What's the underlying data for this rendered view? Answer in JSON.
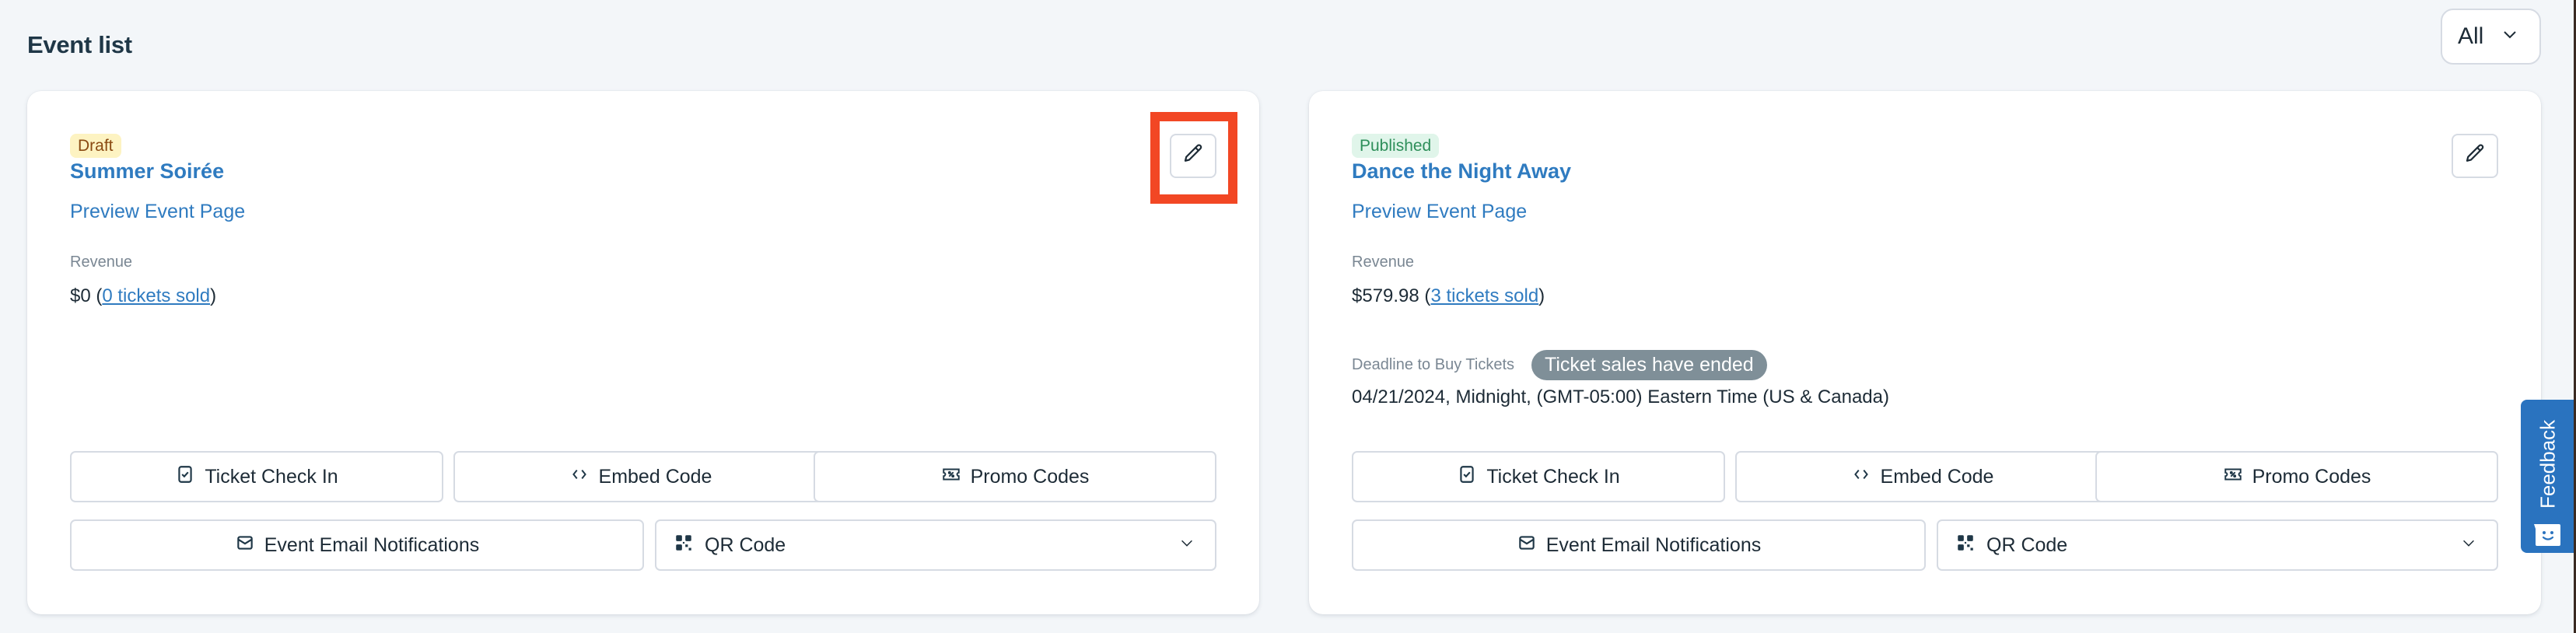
{
  "header": {
    "title": "Event list",
    "filter": {
      "selected": "All",
      "icon": "chevron-down-icon"
    }
  },
  "events": [
    {
      "status": "Draft",
      "status_color": "#fdf3c2",
      "title": "Summer Soirée",
      "preview_link": "Preview Event Page",
      "revenue_label": "Revenue",
      "revenue_amount": "$0",
      "tickets_sold": "0 tickets sold",
      "edit_icon": "pencil-icon",
      "highlighted": true,
      "buttons": {
        "ticket_check_in": "Ticket Check In",
        "embed_code": "Embed Code",
        "promo_codes": "Promo Codes",
        "email_notifications": "Event Email Notifications",
        "qr_code": "QR Code"
      }
    },
    {
      "status": "Published",
      "status_color": "#e0f5ea",
      "title": "Dance the Night Away",
      "preview_link": "Preview Event Page",
      "revenue_label": "Revenue",
      "revenue_amount": "$579.98",
      "tickets_sold": "3 tickets sold",
      "deadline_label": "Deadline to Buy Tickets",
      "deadline_status": "Ticket sales have ended",
      "deadline_value": "04/21/2024, Midnight, (GMT-05:00) Eastern Time (US & Canada)",
      "edit_icon": "pencil-icon",
      "highlighted": false,
      "buttons": {
        "ticket_check_in": "Ticket Check In",
        "embed_code": "Embed Code",
        "promo_codes": "Promo Codes",
        "email_notifications": "Event Email Notifications",
        "qr_code": "QR Code"
      }
    }
  ],
  "feedback": {
    "label": "Feedback",
    "color": "#2a73bf"
  },
  "colors": {
    "accent": "#2f7bc0",
    "highlight": "#f24724",
    "ended_pill": "#7f8f98"
  }
}
